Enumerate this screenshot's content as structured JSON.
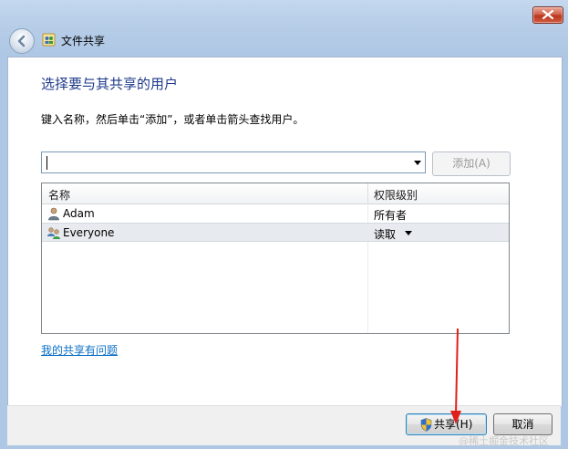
{
  "window": {
    "title": "文件共享"
  },
  "main": {
    "heading": "选择要与其共享的用户",
    "instruction": "键入名称，然后单击“添加”，或者单击箭头查找用户。",
    "name_input": {
      "value": "",
      "placeholder": ""
    },
    "add_button": "添加(A)"
  },
  "table": {
    "columns": [
      "名称",
      "权限级别"
    ],
    "rows": [
      {
        "name": "Adam",
        "permission": "所有者",
        "icon": "user-icon",
        "selected": false
      },
      {
        "name": "Everyone",
        "permission": "读取",
        "icon": "group-icon",
        "selected": true
      }
    ]
  },
  "help_link": "我的共享有问题",
  "buttons": {
    "share": "共享(H)",
    "cancel": "取消"
  },
  "watermark": "@稀土掘金技术社区",
  "colors": {
    "heading": "#1e3a8a",
    "link": "#0b6fc6",
    "annotation_arrow": "#e0201b"
  }
}
